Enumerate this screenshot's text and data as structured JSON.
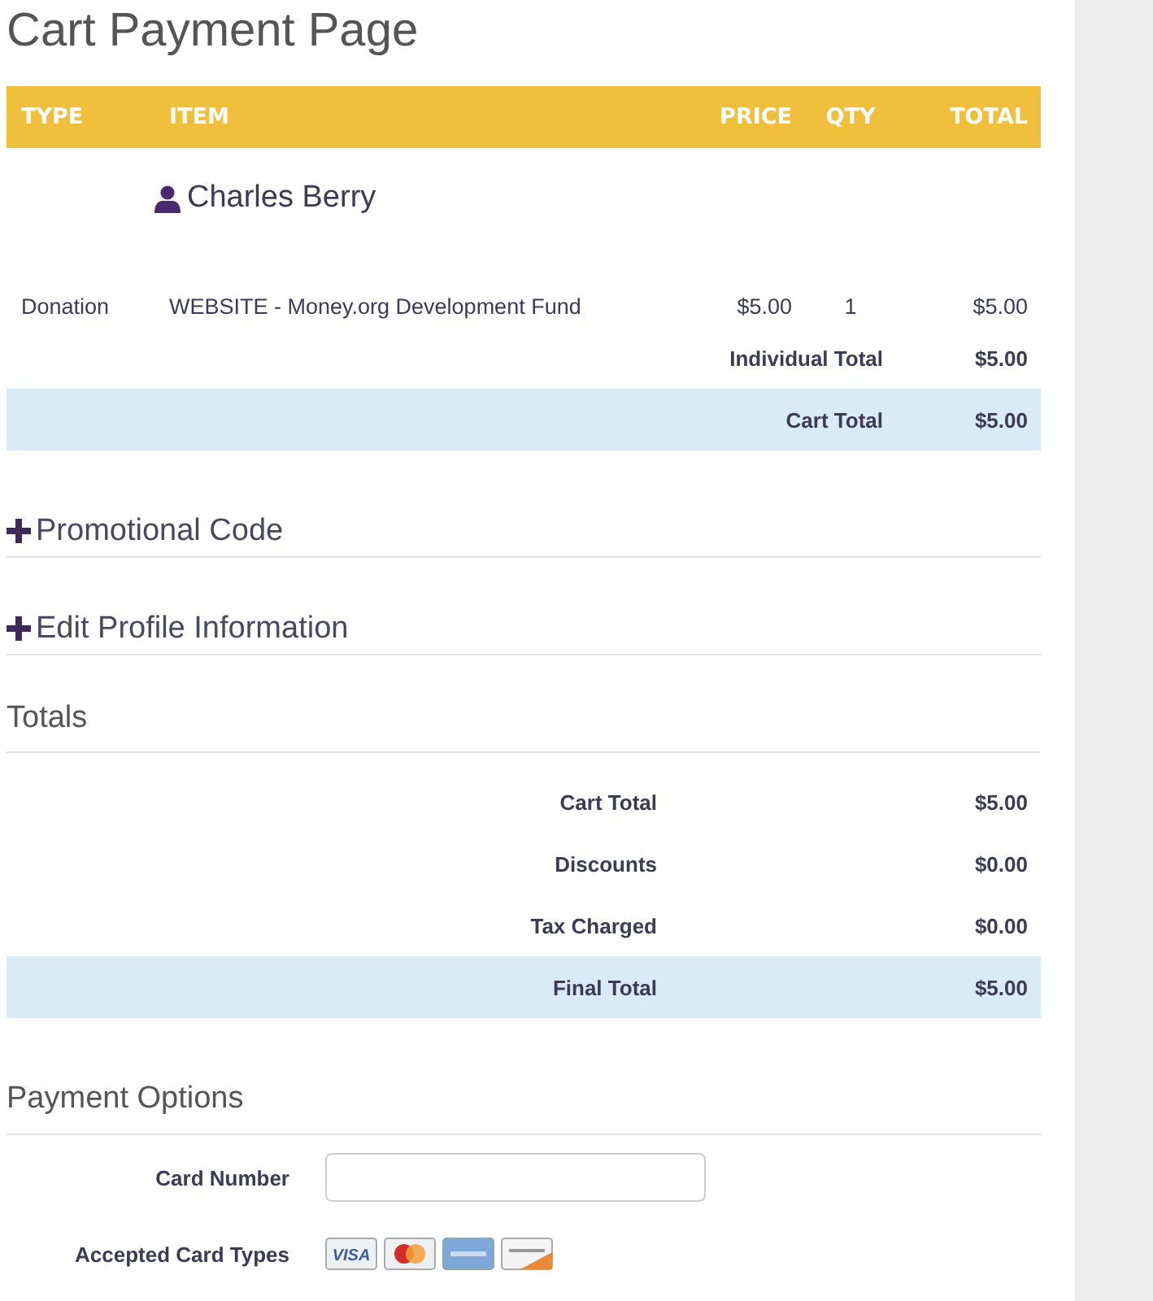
{
  "page": {
    "title": "Cart Payment Page"
  },
  "cart": {
    "columns": [
      "TYPE",
      "ITEM",
      "PRICE",
      "QTY",
      "TOTAL"
    ],
    "customer": "Charles Berry",
    "rows": [
      {
        "type": "Donation",
        "item": "WEBSITE - Money.org Development Fund",
        "price": "$5.00",
        "qty": "1",
        "total": "$5.00"
      }
    ],
    "individual_total": {
      "label": "Individual Total",
      "value": "$5.00"
    },
    "cart_total": {
      "label": "Cart Total",
      "value": "$5.00"
    }
  },
  "sections": [
    {
      "label": "Promotional Code",
      "expanded": false
    },
    {
      "label": "Edit Profile Information",
      "expanded": false
    }
  ],
  "totals": {
    "heading": "Totals",
    "rows": [
      {
        "label": "Cart Total",
        "value": "$5.00",
        "kind": "plain"
      },
      {
        "label": "Discounts",
        "value": "$0.00",
        "kind": "plain"
      },
      {
        "label": "Tax Charged",
        "value": "$0.00",
        "kind": "plain"
      },
      {
        "label": "Final Total",
        "value": "$5.00",
        "kind": "final"
      }
    ]
  },
  "payment": {
    "heading": "Payment Options",
    "card_number_label": "Card Number",
    "accepted_label": "Accepted Card Types",
    "cards": [
      {
        "kind": "visa",
        "label": "VISA"
      },
      {
        "kind": "mastercard"
      },
      {
        "kind": "amex"
      },
      {
        "kind": "discover"
      }
    ]
  }
}
